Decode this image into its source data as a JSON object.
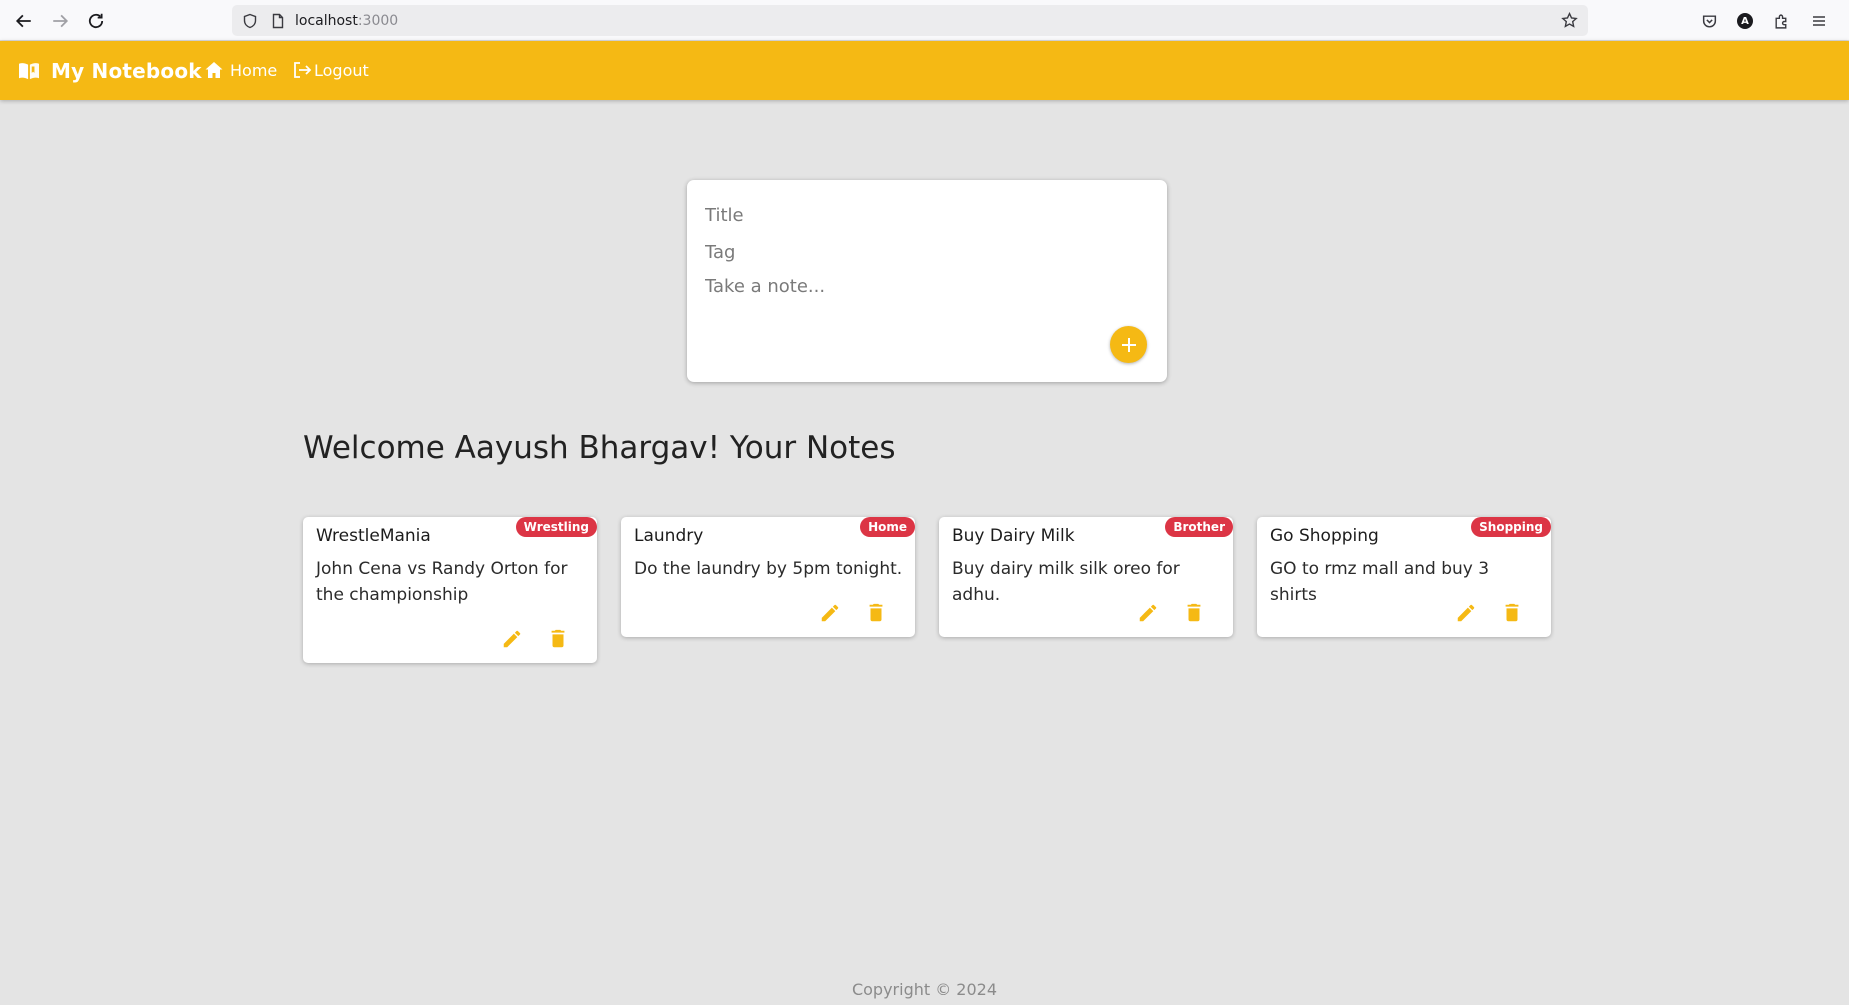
{
  "browser": {
    "url_host": "localhost",
    "url_port": ":3000",
    "avatar_letter": "A"
  },
  "header": {
    "brand": "My Notebook",
    "nav": {
      "home": "Home",
      "logout": "Logout"
    },
    "bg_color": "#f5b914"
  },
  "create_note": {
    "title_placeholder": "Title",
    "tag_placeholder": "Tag",
    "note_placeholder": "Take a note..."
  },
  "welcome": "Welcome Aayush Bhargav! Your Notes",
  "notes": [
    {
      "title": "WrestleMania",
      "tag": "Wrestling",
      "body": "John Cena vs Randy Orton for the championship"
    },
    {
      "title": "Laundry",
      "tag": "Home",
      "body": "Do the laundry by 5pm tonight."
    },
    {
      "title": "Buy Dairy Milk",
      "tag": "Brother",
      "body": "Buy dairy milk silk oreo for adhu."
    },
    {
      "title": "Go Shopping",
      "tag": "Shopping",
      "body": "GO to rmz mall and buy 3 shirts"
    }
  ],
  "footer": "Copyright © 2024",
  "colors": {
    "accent": "#f5b914",
    "badge": "#dc3545",
    "background": "#e4e4e4"
  }
}
